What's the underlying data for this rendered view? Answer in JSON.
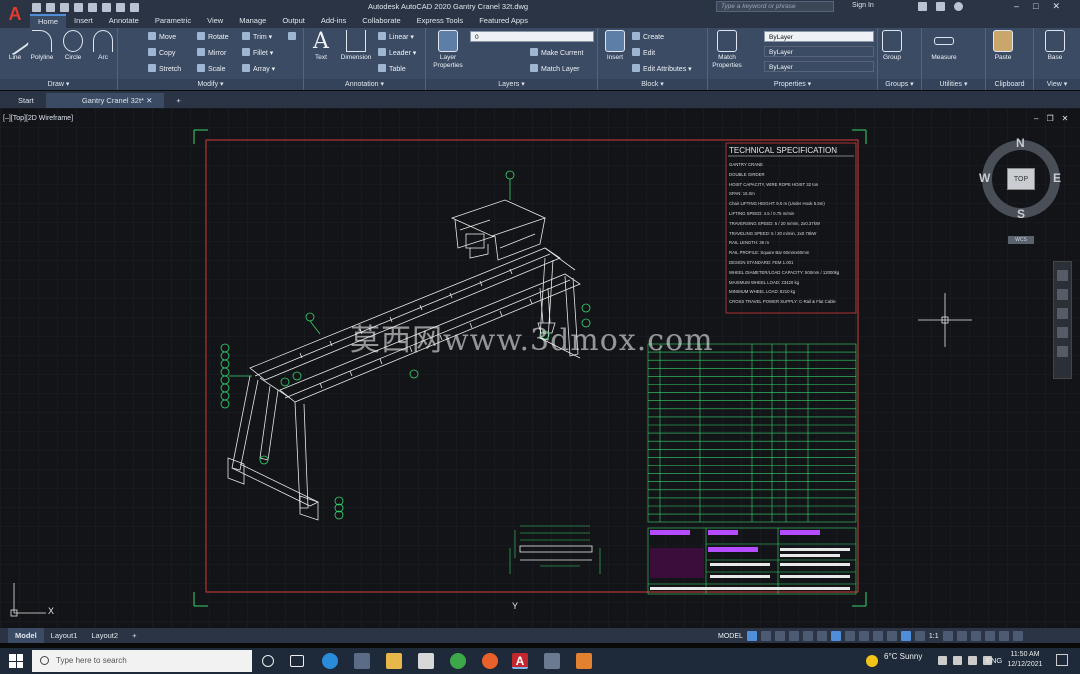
{
  "window": {
    "app_icon": "A",
    "title": "Autodesk AutoCAD 2020     Gantry Cranel 32t.dwg",
    "search_placeholder": "Type a keyword or phrase",
    "sign_in": "Sign In"
  },
  "ribbon_tabs": [
    "Home",
    "Insert",
    "Annotate",
    "Parametric",
    "View",
    "Manage",
    "Output",
    "Add-ins",
    "Collaborate",
    "Express Tools",
    "Featured Apps"
  ],
  "active_tab": "Home",
  "panels": {
    "draw": {
      "title": "Draw ▾",
      "tools": [
        "Line",
        "Polyline",
        "Circle",
        "Arc"
      ]
    },
    "modify": {
      "title": "Modify ▾",
      "tools": [
        "Move",
        "Rotate",
        "Trim ▾",
        "Copy",
        "Mirror",
        "Fillet ▾",
        "Stretch",
        "Scale",
        "Array ▾"
      ]
    },
    "annotation": {
      "title": "Annotation ▾",
      "text": "Text",
      "dimension": "Dimension",
      "tools": [
        "Linear ▾",
        "Leader ▾",
        "Table"
      ]
    },
    "layers": {
      "title": "Layers ▾",
      "props": "Layer Properties",
      "layer_value": "0",
      "tools": [
        "Make Current",
        "Match Layer"
      ]
    },
    "block": {
      "title": "Block ▾",
      "insert": "Insert",
      "tools": [
        "Create",
        "Edit",
        "Edit Attributes ▾"
      ]
    },
    "properties": {
      "title": "Properties ▾",
      "match": "Match Properties",
      "bylayer": [
        "ByLayer",
        "ByLayer",
        "ByLayer"
      ]
    },
    "groups": {
      "title": "Groups ▾",
      "label": "Group"
    },
    "utilities": {
      "title": "Utilities ▾",
      "label": "Measure"
    },
    "clipboard": {
      "title": "Clipboard",
      "label": "Paste"
    },
    "view": {
      "title": "View ▾",
      "label": "Base"
    }
  },
  "doc_tabs": [
    "Start",
    "Gantry Cranel 32t*"
  ],
  "viewport_label": "[–][Top][2D Wireframe]",
  "viewcube": {
    "n": "N",
    "s": "S",
    "e": "E",
    "w": "W",
    "top": "TOP",
    "wcs": "WCS"
  },
  "watermark": "莫西网www.3dmox.com",
  "tech_spec": {
    "title": "TECHNICAL SPECIFICATION",
    "lines": [
      "GANTRY CRANE",
      "DOUBLE GIRDER",
      "HOIST CAPACITY, WIRE ROPE HOIST 32 ton",
      "SPAN: 15.0m",
      "Chair LIFTING HEIGHT: 9.0 m (Under Hook 5.5m)",
      "LIFTING SPEED: 4.5 / 0.75 m/min",
      "TRAVERSING SPEED: 5 / 20 m/min, 2x0.37kW",
      "TRAVELING SPEED: 5 / 20 m/min, 2x0.75kW",
      "RAIL LENGTH: 36 m",
      "RAIL PROFILE: Square Bar 60mmx60mm",
      "DESIGN STANDARD: FEM 1.001",
      "WHEEL DIAMETER/LOAD CAPACITY: 500mm / 12000kg",
      "MAXIMUM WHEEL LOAD: 23420 kg",
      "MINIMUM WHEEL LOAD: 8210 kg",
      "CROSS TRAVEL POWER SUPPLY: C-Rail & Flat Cable"
    ]
  },
  "layout_tabs": [
    "Model",
    "Layout1",
    "Layout2"
  ],
  "status": {
    "model": "MODEL",
    "scale": "1:1"
  },
  "taskbar": {
    "search_placeholder": "Type here to search",
    "weather": "6°C  Sunny",
    "lang": "ENG",
    "time": "11:50 AM",
    "date": "12/12/2021"
  },
  "colors": {
    "accent": "#4f8fd9",
    "drawing_green": "#39d36b",
    "border_red": "#d23a3a",
    "autocad_red": "#e23b2e"
  }
}
